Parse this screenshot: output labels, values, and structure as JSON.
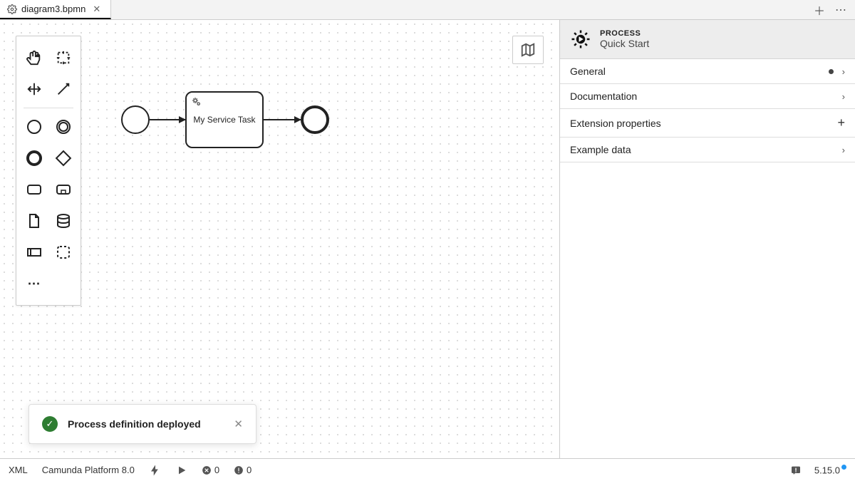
{
  "tab": {
    "title": "diagram3.bpmn"
  },
  "diagram": {
    "task_label": "My Service Task"
  },
  "toast": {
    "message": "Process definition deployed"
  },
  "properties": {
    "type_label": "PROCESS",
    "name": "Quick Start",
    "sections": {
      "general": "General",
      "documentation": "Documentation",
      "extension": "Extension properties",
      "example": "Example data"
    }
  },
  "statusbar": {
    "xml": "XML",
    "platform": "Camunda Platform 8.0",
    "errors": "0",
    "warnings": "0",
    "version": "5.15.0"
  }
}
